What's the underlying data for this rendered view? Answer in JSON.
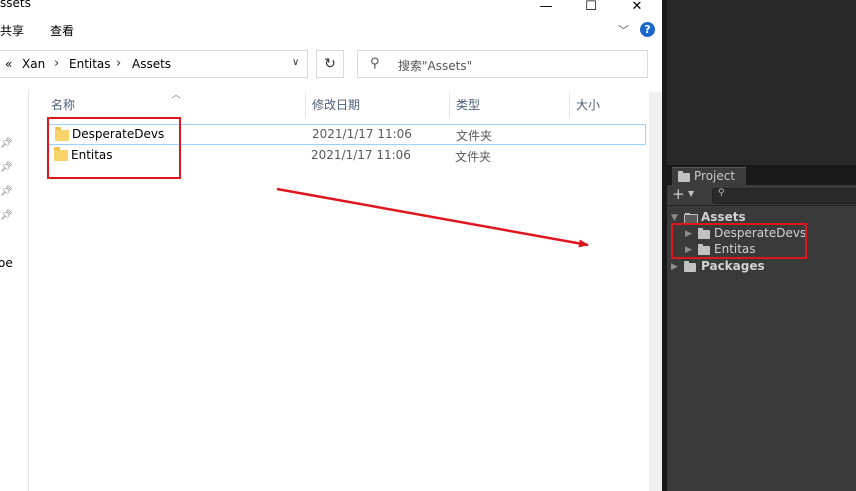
{
  "explorer": {
    "title": "ssets",
    "window_controls": {
      "minimize": "—",
      "maximize": "☐",
      "close": "✕"
    },
    "ribbon": {
      "tabs": [
        "共享",
        "查看"
      ]
    },
    "address": {
      "overflow": "«",
      "crumbs": [
        "Xan",
        "Entitas",
        "Assets"
      ],
      "separator": "›"
    },
    "search_placeholder": "搜索\"Assets\"",
    "nav_fragment": "oe",
    "columns": [
      "名称",
      "修改日期",
      "类型",
      "大小"
    ],
    "files": [
      {
        "name": "DesperateDevs",
        "modified": "2021/1/17 11:06",
        "type": "文件夹"
      },
      {
        "name": "Entitas",
        "modified": "2021/1/17 11:06",
        "type": "文件夹"
      }
    ]
  },
  "unity": {
    "project_tab": "Project",
    "tree": {
      "assets": "Assets",
      "children": [
        "DesperateDevs",
        "Entitas"
      ],
      "packages": "Packages"
    }
  },
  "colors": {
    "highlight_box": "#e0161e",
    "arrow": "#e0161e",
    "folder_yellow": "#f8d36a",
    "unity_bg": "#3a3a3a"
  }
}
